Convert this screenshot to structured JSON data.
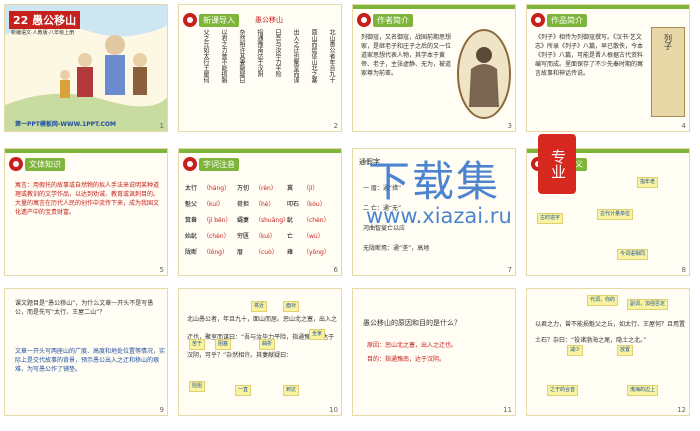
{
  "slides": [
    {
      "num": "1",
      "title": "22 愚公移山",
      "subtitle": "新编语文·人教版·八年级上册",
      "footer": "第一PPT模板网-WWW.1PPT.COM"
    },
    {
      "num": "2",
      "tag": "新课导入",
      "heading": "愚公移山",
      "cols": [
        "北山愚公者年且九十",
        "面山而居惩山北之塞",
        "出入之迂也聚室而谋",
        "曰吾与汝毕力平险",
        "指通豫南达于汉阴",
        "杂然相许其妻献疑曰",
        "以君之力曾不能损魁",
        "父之丘如太行王屋何"
      ]
    },
    {
      "num": "3",
      "tag": "作者简介",
      "text": "列御寇，又名御寇，战国前期思想家，是继老子和庄子之后的又一位道家思想代表人物，其学本于黄帝、老子，主张虚静、无为，被道家尊为前辈。"
    },
    {
      "num": "4",
      "tag": "作品简介",
      "text": "《列子》相传为列御寇撰写。《汉书·艺文志》所录《列子》八篇，早已散佚，今本《列子》八篇，可能是晋人根据古代资料编写而成。里面保存了不少先秦时期的寓言故事和神话传说。",
      "book": "列子"
    },
    {
      "num": "5",
      "tag": "文体知识",
      "text": "寓言：用假托的故事或自然物的拟人手法来说明某种道理或教训的文学作品，以达到劝诫、教育或讽刺目的。大量的寓言在历代人民的创作中流传下来，成为我国文化遗产中的宝贵财富。"
    },
    {
      "num": "6",
      "tag": "字词注音",
      "words": [
        [
          "太行",
          "（háng）",
          "万仞",
          "（rèn）",
          "冀",
          "（jì）"
        ],
        [
          "魁父",
          "（kuí）",
          "荷担",
          "（hè）",
          "叩石",
          "（kòu）"
        ],
        [
          "箕畚",
          "（jī běn）",
          "孀妻",
          "（shuāng）",
          "龀",
          "（chèn）"
        ],
        [
          "始龀",
          "（chèn）",
          "穷匮",
          "（kuì）",
          "亡",
          "（wú）"
        ],
        [
          "陇断",
          "（lǒng）",
          "厝",
          "（cuò）",
          "雍",
          "（yōng）"
        ]
      ]
    },
    {
      "num": "7",
      "tag": "通假字",
      "rows": [
        "一 厝：通“措”",
        "二 亡：通“无”",
        "河曲智叟亡以应",
        "无陇断焉：通“垄”，高地"
      ]
    },
    {
      "num": "8",
      "tag": "古词今义",
      "bubbles": [
        "指年老",
        "古代计量单位",
        "古时造字",
        "今词语相同"
      ],
      "big": "专业"
    },
    {
      "num": "9",
      "question": "课文题目是“愚公移山”，为什么文章一开头不是写愚公，而是先写“太行、王屋二山”？",
      "answer": "文章一开头写两座山的广度、高度和地处位置等情况，实际上是交代故事的背景，预示愚公出入之迂和移山的艰难，为写愚公作了铺垫。"
    },
    {
      "num": "10",
      "text": "北山愚公者，年且九十，面山而居。惩山北之塞，出入之迂也，聚室而谋曰：“吾与汝毕力平险，指通豫南，达于汉阴，可乎？”杂然相许。其妻献疑曰：",
      "bubbles": [
        "将近",
        "面对",
        "苦于",
        "阻塞",
        "曲折",
        "全家",
        "险阻",
        "一直",
        "到达"
      ]
    },
    {
      "num": "11",
      "question": "愚公移山的原因和目的是什么？",
      "reason": "原因：惩山北之塞，出入之迂也。",
      "goal": "目的：指通豫南，达于汉阴。"
    },
    {
      "num": "12",
      "text": "以君之力，曾不能损魁父之丘，如太行、王屋何？且焉置土石？杂曰：“投诸渤海之尾，隐土之北。”",
      "bubbles": [
        "代词，你的",
        "副词，加强否定",
        "减少",
        "放置",
        "之于的合音",
        "渤海的边上"
      ]
    }
  ],
  "watermark": {
    "big": "下载集",
    "url": "www.xiazai.ru",
    "seal": "专业"
  }
}
